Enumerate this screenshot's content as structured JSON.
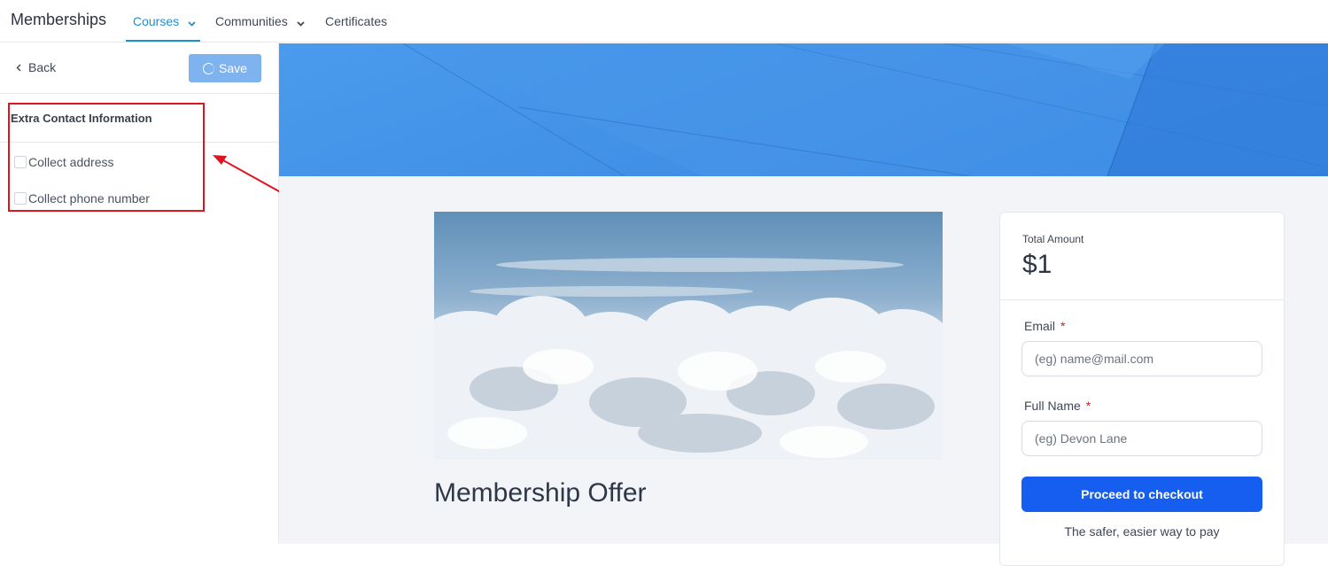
{
  "nav": {
    "brand": "Memberships",
    "items": [
      {
        "label": "Courses",
        "active": true,
        "has_dropdown": true
      },
      {
        "label": "Communities",
        "active": false,
        "has_dropdown": true
      },
      {
        "label": "Certificates",
        "active": false,
        "has_dropdown": false
      }
    ]
  },
  "sidebar": {
    "back_label": "Back",
    "save_label": "Save",
    "section_title": "Extra Contact Information",
    "options": [
      {
        "label": "Collect address",
        "checked": false
      },
      {
        "label": "Collect phone number",
        "checked": false
      }
    ]
  },
  "offer": {
    "title": "Membership Offer"
  },
  "checkout": {
    "total_label": "Total Amount",
    "total_amount": "$1",
    "email_label": "Email",
    "email_placeholder": "(eg) name@mail.com",
    "name_label": "Full Name",
    "name_placeholder": "(eg) Devon Lane",
    "required_mark": "*",
    "button_label": "Proceed to checkout",
    "tagline": "The safer, easier way to pay"
  },
  "colors": {
    "accent": "#1e8fcf",
    "primary_button": "#155eef",
    "save_button": "#7fb3ef",
    "highlight": "#e0141e",
    "hero": "#3f8fe6"
  },
  "icons": {
    "back": "chevron-left-icon",
    "dropdown": "chevron-down-icon",
    "loading": "spinner-icon"
  }
}
